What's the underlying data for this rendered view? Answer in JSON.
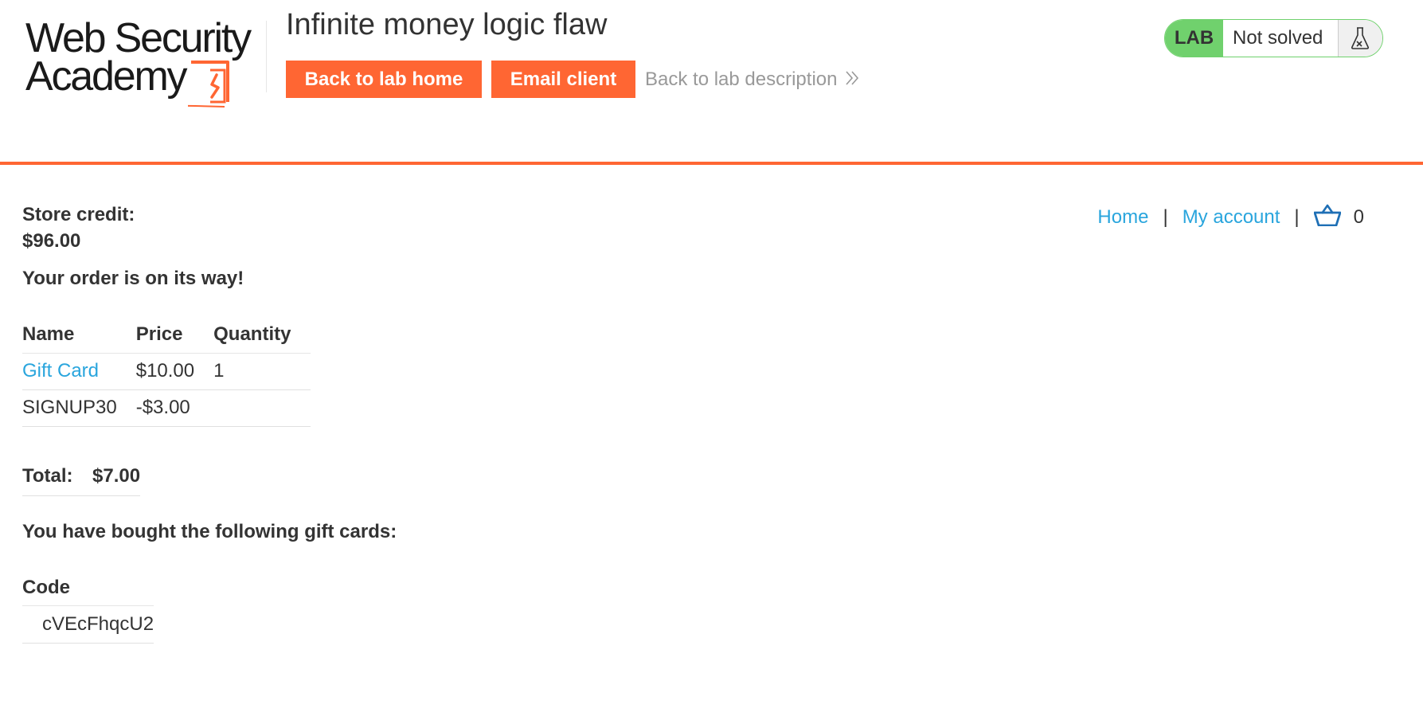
{
  "header": {
    "logo": {
      "line1": "Web Security",
      "line2": "Academy"
    },
    "lab_title": "Infinite money logic flaw",
    "back_to_lab_home": "Back to lab home",
    "email_client": "Email client",
    "back_to_lab_description": "Back to lab description",
    "lab_badge": "LAB",
    "lab_status": "Not solved"
  },
  "nav": {
    "home": "Home",
    "separator": "|",
    "my_account": "My account",
    "cart_count": "0"
  },
  "store_credit": {
    "label": "Store credit:",
    "value": "$96.00"
  },
  "order_message": "Your order is on its way!",
  "order_table": {
    "headers": [
      "Name",
      "Price",
      "Quantity"
    ],
    "rows": [
      {
        "name": "Gift Card",
        "price": "$10.00",
        "quantity": "1"
      },
      {
        "name": "SIGNUP30",
        "price": "-$3.00",
        "quantity": ""
      }
    ]
  },
  "total": {
    "label": "Total:",
    "value": "$7.00"
  },
  "gift_cards": {
    "heading": "You have bought the following gift cards:",
    "column_header": "Code",
    "codes": [
      "cVEcFhqcU2"
    ]
  },
  "colors": {
    "accent": "#ff6633",
    "link": "#29a5dd",
    "lab_green": "#70d16d",
    "text": "#333333"
  },
  "icons": {
    "logo_mark": "academy-logo-mark",
    "chevron": "double-chevron-right-icon",
    "flask": "flask-icon",
    "cart": "shopping-basket-icon"
  }
}
